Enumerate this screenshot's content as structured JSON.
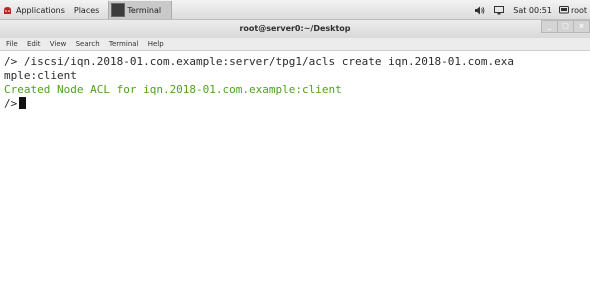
{
  "top_panel": {
    "applications_label": "Applications",
    "places_label": "Places",
    "task_label": "Terminal",
    "clock": "Sat 00:51",
    "user": "root"
  },
  "window": {
    "title": "root@server0:~/Desktop"
  },
  "menubar": {
    "items": [
      "File",
      "Edit",
      "View",
      "Search",
      "Terminal",
      "Help"
    ]
  },
  "terminal": {
    "line1": "/> /iscsi/iqn.2018-01.com.example:server/tpg1/acls create iqn.2018-01.com.exa",
    "line2": "mple:client",
    "line3": "Created Node ACL for iqn.2018-01.com.example:client",
    "line4": "/>",
    "output_color": "#4ea11e"
  }
}
